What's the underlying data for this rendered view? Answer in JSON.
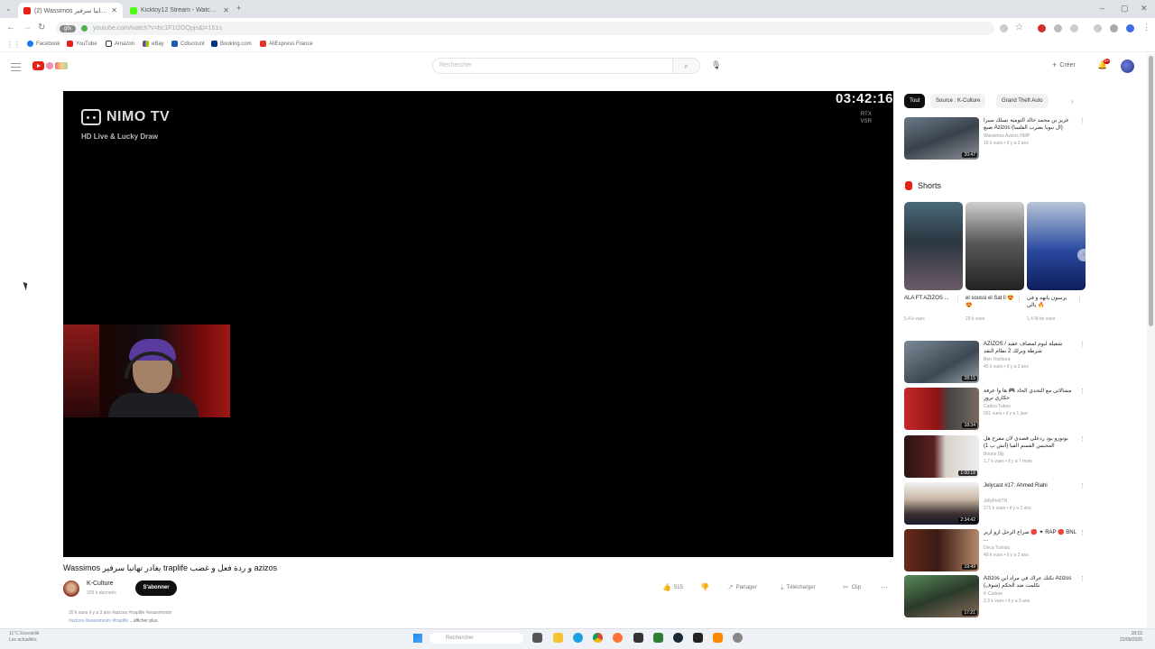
{
  "browser": {
    "tabs": [
      {
        "label": "(2) Wassimos ورد علي تهانيا سرفير traplife و بغادر",
        "favicon_color": "#e62117",
        "active": true
      },
      {
        "label": "Kicktoy12 Stream - Watch Li...",
        "favicon_color": "#53fc18",
        "active": false
      }
    ],
    "new_tab": "+",
    "url": "youtube.com/watch?v=bc1F1t2OQpjs&t=161s",
    "site_chip": "gfx",
    "bookmarks": [
      {
        "label": "Facebook",
        "color": "#1877f2"
      },
      {
        "label": "YouTube",
        "color": "#e62117"
      },
      {
        "label": "Amazon",
        "color": "#222222"
      },
      {
        "label": "eBay",
        "color": "#e53238"
      },
      {
        "label": "Cdiscount",
        "color": "#1e5ab8"
      },
      {
        "label": "Booking.com",
        "color": "#003580"
      },
      {
        "label": "AliExpress France",
        "color": "#e43225"
      }
    ]
  },
  "youtube": {
    "search_placeholder": "Rechercher",
    "create_label": "Créer",
    "notification_count": "9+"
  },
  "player": {
    "overlay_brand": "NIMO TV",
    "overlay_tagline": "HD Live & Lucky Draw",
    "timer": "03:42:16",
    "badge_line1": "RTX",
    "badge_line2": "VSR"
  },
  "video": {
    "title": "Wassimos يغادر تهانيا سرفير traplife و ردة فعل و غضب azizos",
    "channel_name": "K-Culture",
    "channel_subs": "329 k abonnés",
    "subscribe_label": "S'abonner",
    "likes": "515",
    "share_label": "Partager",
    "download_label": "Télécharger",
    "clip_label": "Clip",
    "meta": "20 k vues  il y a 3 ans  #azizos #traplife #wassimostv",
    "hashtags": "#azizos #wassimostv #traplife",
    "show_more": "...afficher plus"
  },
  "sidebar": {
    "chips": [
      "Tout",
      "Source : K-Culture",
      "Grand Theft Auto"
    ],
    "shorts_title": "Shorts",
    "shorts": [
      {
        "title": "ALA FT AZIZOS ...",
        "views": "5,4 k vues"
      },
      {
        "title": "el soussi el Sat li 😍😍",
        "views": "29 k vues"
      },
      {
        "title": "يرسون يانهه و في يالي 🔥",
        "views": "1,4 M de vues"
      }
    ],
    "videos": [
      {
        "title": "عزيز بن محمد خالد التومية نسلك سيرا ضيع Azizos (ال نبويا بضرب الفلسا)",
        "channel": "Wassimos Azizos NMP",
        "meta": "15 k vues • il y a 3 ans",
        "duration": "20:47"
      },
      {
        "title": "AZIZOS / شعيلة لبوم لمضاف عقيد شرطة وبرلك 2 نظام النقد",
        "channel": "Ben Yoshiera",
        "meta": "45 k vues • il y a 3 ans",
        "duration": "28:15"
      },
      {
        "title": "مشالاتي مع التحدي الحاد 🎮 ها وا عرفة حكاري تروز",
        "channel": "Cadou Tubes",
        "meta": "501 vues • il y a 1 jour",
        "duration": "18:34"
      },
      {
        "title": "بونوزو بود ردعلى قصدي لان مفرح هل المحبس القسم الفيا (أتش ب 1)",
        "channel": "Bouns Djij",
        "meta": "1,7 k vues • il y a 7 mois",
        "duration": "1:00:18"
      },
      {
        "title": "Jelycast #17: Ahmed Riahi",
        "channel": "JellyFishTN",
        "meta": "171 k vues • il y a 2 ans",
        "duration": "2:34:42"
      },
      {
        "title": "صراع الرجل ازو ازيز 🔴 ✦ RAP 🔴 BNL ...",
        "channel": "Deca Tunisia",
        "meta": "49 k vues • il y a 2 ans",
        "duration": "19:49"
      },
      {
        "title": "Azizos تكتك عراك في مراد ابن Azizos تكلمت ضد الحكم (شوف)",
        "channel": "K-Culture",
        "meta": "2,3 k vues • il y a 3 ans",
        "duration": "17:21"
      }
    ]
  },
  "taskbar": {
    "weather_line1": "11°C Ensoleillé",
    "weather_line2": "Les actualités",
    "search_placeholder": "Rechercher",
    "time": "18:15",
    "date": "22/09/2025"
  }
}
